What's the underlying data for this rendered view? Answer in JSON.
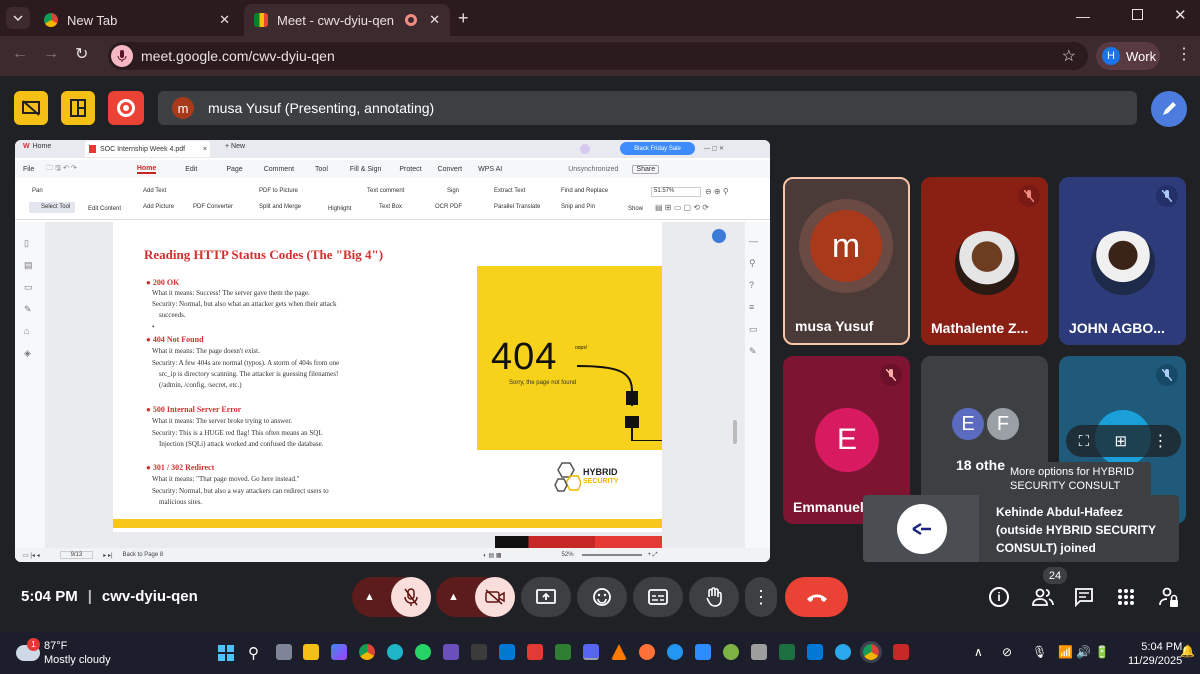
{
  "browser": {
    "tabs": [
      {
        "label": "New Tab"
      },
      {
        "label": "Meet - cwv-dyiu-qen"
      }
    ],
    "url": "meet.google.com/cwv-dyiu-qen",
    "profile_initial": "H",
    "profile_label": "Work"
  },
  "meet": {
    "presenter_initial": "m",
    "banner": "musa Yusuf (Presenting, annotating)",
    "time": "5:04 PM",
    "separator": "|",
    "meeting_code": "cwv-dyiu-qen",
    "participants_badge": "24",
    "tiles": [
      {
        "initial": "m",
        "name": "musa Yusuf",
        "color": "#a8391a"
      },
      {
        "name": "Mathalente Z..."
      },
      {
        "name": "JOHN AGBO..."
      },
      {
        "initial": "E",
        "name": "Emmanuel",
        "color": "#d81b60"
      },
      {
        "initials": [
          "E",
          "F"
        ],
        "name": "18 othe"
      },
      {
        "name": ""
      }
    ],
    "tooltip": "More options for HYBRID SECURITY CONSULT",
    "toast": "Kehinde Abdul-Hafeez (outside HYBRID SECURITY CONSULT) joined",
    "colors": {
      "end_call": "#ea4335",
      "accent": "#8ab4f8",
      "tile_bg": "#3c4043"
    }
  },
  "pdf": {
    "tabs": [
      "Home",
      "SOC Internship Week 4.pdf",
      "New"
    ],
    "black_friday": "Black Friday Sale",
    "unsync": "Unsynchronized",
    "share": "Share",
    "menu": [
      "File",
      "Home",
      "Edit",
      "Page",
      "Comment",
      "Tool",
      "Fill & Sign",
      "Protect",
      "Convert",
      "WPS AI"
    ],
    "ribbon": [
      "Pan",
      "Select Tool",
      "Edit Content",
      "Add Text",
      "Add Picture",
      "PDF to Picture",
      "PDF Converter",
      "Split and Merge",
      "Highlight",
      "Text comment",
      "Text Box",
      "Sign",
      "OCR PDF",
      "Extract Text",
      "Parallel Translate",
      "Find and Replace",
      "Snip and Pin",
      "Show",
      "51.57%"
    ],
    "title": "Reading HTTP Status Codes (The \"Big 4\")",
    "sections": [
      {
        "heading": "200 OK",
        "lines": [
          "What it means: Success! The server gave them the page.",
          "Security: Normal, but also what an attacker gets when their attack",
          "succeeds."
        ]
      },
      {
        "heading": "404 Not Found",
        "lines": [
          "What it means: The page doesn't exist.",
          "Security: A few 404s are normal (typos). A storm of 404s from one",
          "src_ip is directory scanning. The attacker is guessing filenames!",
          "(/admin, /config, /secret, etc.)"
        ]
      },
      {
        "heading": "500 Internal Server Error",
        "lines": [
          "What it means: The server broke trying to answer.",
          "Security: This is a HUGE red flag! This often means an SQL",
          "Injection (SQLi) attack worked and confused the database."
        ]
      },
      {
        "heading": "301 / 302 Redirect",
        "lines": [
          "What it means: \"That page moved. Go here instead.\"",
          "Security: Normal, but also a way attackers can redirect users to",
          "malicious sites."
        ]
      }
    ],
    "img404": "404",
    "img_oops": "oops!",
    "img_sub": "Sorry, the page not found",
    "logo_text": "HYBRID",
    "logo_sub": "SECURITY",
    "page": "9/13",
    "back": "Back to Page 8",
    "zoom": "52%"
  },
  "taskbar": {
    "temp": "87°F",
    "weather": "Mostly cloudy",
    "weather_badge": "1",
    "time": "5:04 PM",
    "date": "11/29/2025"
  }
}
